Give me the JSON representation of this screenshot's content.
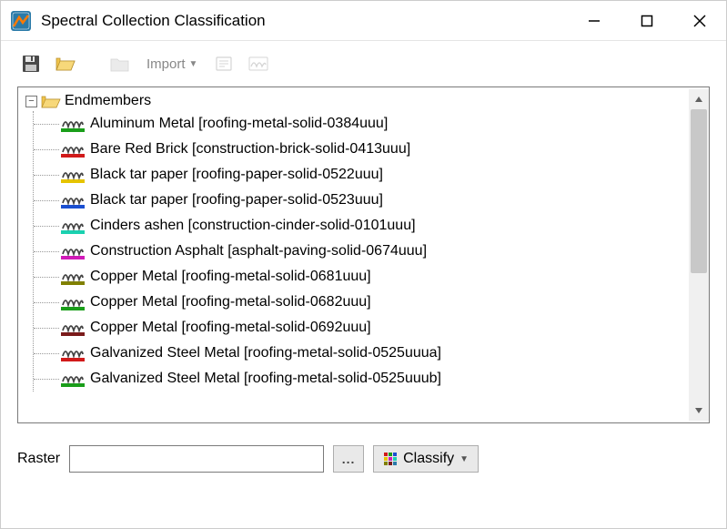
{
  "window": {
    "title": "Spectral Collection Classification"
  },
  "toolbar": {
    "import_label": "Import"
  },
  "tree": {
    "root_label": "Endmembers",
    "items": [
      {
        "label": "Aluminum Metal [roofing-metal-solid-0384uuu]",
        "color": "#1a9e1a"
      },
      {
        "label": "Bare Red Brick [construction-brick-solid-0413uuu]",
        "color": "#d11a1a"
      },
      {
        "label": "Black tar paper [roofing-paper-solid-0522uuu]",
        "color": "#e6c400"
      },
      {
        "label": "Black tar paper [roofing-paper-solid-0523uuu]",
        "color": "#1a4fd1"
      },
      {
        "label": "Cinders ashen [construction-cinder-solid-0101uuu]",
        "color": "#1ad1b0"
      },
      {
        "label": "Construction Asphalt [asphalt-paving-solid-0674uuu]",
        "color": "#d11ab8"
      },
      {
        "label": "Copper Metal [roofing-metal-solid-0681uuu]",
        "color": "#808000"
      },
      {
        "label": "Copper Metal [roofing-metal-solid-0682uuu]",
        "color": "#1a9e1a"
      },
      {
        "label": "Copper Metal [roofing-metal-solid-0692uuu]",
        "color": "#7a1a1a"
      },
      {
        "label": "Galvanized Steel Metal [roofing-metal-solid-0525uuua]",
        "color": "#d11a1a"
      },
      {
        "label": "Galvanized Steel Metal [roofing-metal-solid-0525uuub]",
        "color": "#1a9e1a"
      }
    ]
  },
  "bottom": {
    "raster_label": "Raster",
    "classify_label": "Classify"
  }
}
